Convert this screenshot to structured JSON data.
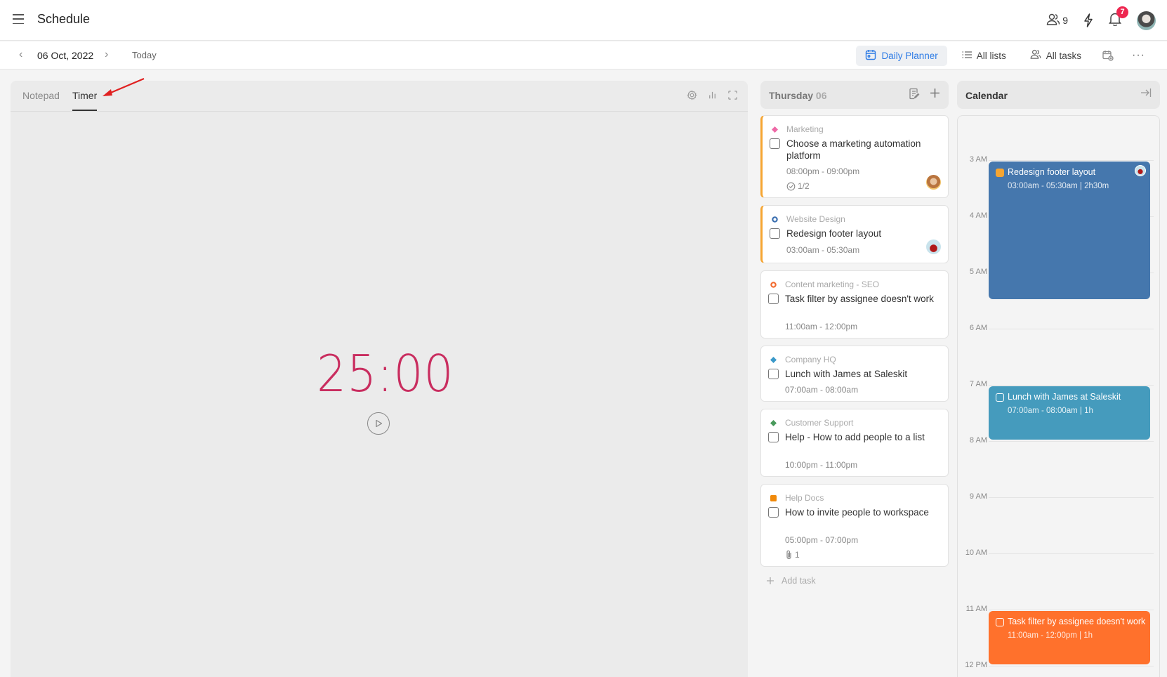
{
  "header": {
    "title": "Schedule",
    "members_count": "9",
    "notifications_count": "7"
  },
  "subbar": {
    "date": "06 Oct, 2022",
    "today_label": "Today",
    "views": [
      {
        "label": "Daily Planner",
        "icon": "calendar-icon",
        "active": true
      },
      {
        "label": "All lists",
        "icon": "list-icon",
        "active": false
      },
      {
        "label": "All tasks",
        "icon": "users-icon",
        "active": false
      }
    ]
  },
  "left_panel": {
    "tabs": [
      {
        "label": "Notepad",
        "active": false
      },
      {
        "label": "Timer",
        "active": true
      }
    ],
    "timer": {
      "value": "25:00",
      "color": "#c92d5f"
    }
  },
  "tasks": {
    "day_name": "Thursday",
    "day_num": "06",
    "add_task_label": "Add task",
    "items": [
      {
        "category": "Marketing",
        "category_color": "#ee6aa7",
        "shape": "diamond",
        "title": "Choose a marketing automation platform",
        "time": "08:00pm - 09:00pm",
        "meta": "1/2",
        "meta_icon": "checklist-icon",
        "flagged": true
      },
      {
        "category": "Website Design",
        "category_color": "#3b6fb0",
        "shape": "ring",
        "title": "Redesign footer layout",
        "time": "03:00am - 05:30am",
        "flagged": true
      },
      {
        "category": "Content marketing - SEO",
        "category_color": "#f26b2f",
        "shape": "ring",
        "title": "Task filter by assignee doesn't work",
        "time": "11:00am - 12:00pm",
        "flagged": false
      },
      {
        "category": "Company HQ",
        "category_color": "#3b99c9",
        "shape": "diamond",
        "title": "Lunch with James at Saleskit",
        "time": "07:00am - 08:00am",
        "flagged": false
      },
      {
        "category": "Customer Support",
        "category_color": "#4a9a5c",
        "shape": "diamond",
        "title": "Help - How to add people to a list",
        "time": "10:00pm - 11:00pm",
        "flagged": false
      },
      {
        "category": "Help Docs",
        "category_color": "#f0890a",
        "shape": "square",
        "title": "How to invite people to workspace",
        "time": "05:00pm - 07:00pm",
        "meta": "1",
        "meta_icon": "paperclip-icon",
        "flagged": false
      }
    ]
  },
  "calendar": {
    "title": "Calendar",
    "hours": [
      "3 AM",
      "4 AM",
      "5 AM",
      "6 AM",
      "7 AM",
      "8 AM",
      "9 AM",
      "10 AM",
      "11 AM",
      "12 PM"
    ],
    "events": [
      {
        "title": "Redesign footer layout",
        "time": "03:00am - 05:30am | 2h30m",
        "color": "#4577ad"
      },
      {
        "title": "Lunch with James at Saleskit",
        "time": "07:00am - 08:00am | 1h",
        "color": "#459bbd"
      },
      {
        "title": "Task filter by assignee doesn't work",
        "time": "11:00am - 12:00pm | 1h",
        "color": "#ff712c"
      }
    ]
  }
}
